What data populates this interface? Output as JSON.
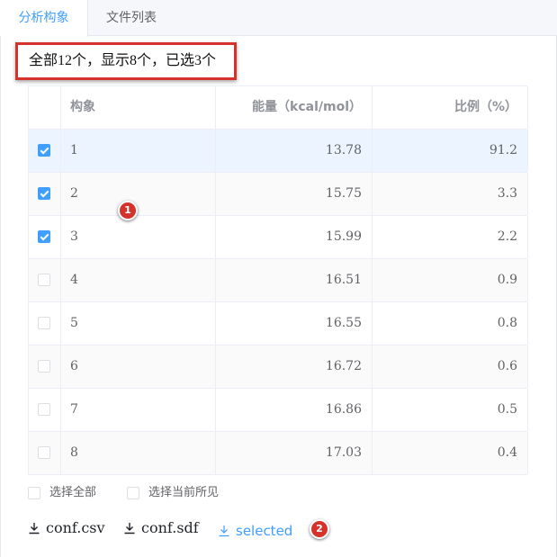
{
  "tabs": [
    {
      "label": "分析构象",
      "active": true
    },
    {
      "label": "文件列表",
      "active": false
    }
  ],
  "summary": "全部12个，显示8个，已选3个",
  "table": {
    "columns": [
      "构象",
      "能量（kcal/mol）",
      "比例（%）"
    ],
    "rows": [
      {
        "checked": true,
        "id": "1",
        "energy": "13.78",
        "ratio": "91.2"
      },
      {
        "checked": true,
        "id": "2",
        "energy": "15.75",
        "ratio": "3.3"
      },
      {
        "checked": true,
        "id": "3",
        "energy": "15.99",
        "ratio": "2.2"
      },
      {
        "checked": false,
        "id": "4",
        "energy": "16.51",
        "ratio": "0.9"
      },
      {
        "checked": false,
        "id": "5",
        "energy": "16.55",
        "ratio": "0.8"
      },
      {
        "checked": false,
        "id": "6",
        "energy": "16.72",
        "ratio": "0.6"
      },
      {
        "checked": false,
        "id": "7",
        "energy": "16.86",
        "ratio": "0.5"
      },
      {
        "checked": false,
        "id": "8",
        "energy": "17.03",
        "ratio": "0.4"
      }
    ]
  },
  "select_options": {
    "select_all": "选择全部",
    "select_current": "选择当前所见"
  },
  "downloads": {
    "csv": "conf.csv",
    "sdf": "conf.sdf",
    "selected": "selected"
  },
  "annotations": [
    "1",
    "2"
  ],
  "colors": {
    "accent": "#409eff",
    "annotation": "#d6322c",
    "highlight_row": "#ecf5ff"
  },
  "icons": {
    "download": "download-icon",
    "checkbox": "checkbox-icon"
  }
}
